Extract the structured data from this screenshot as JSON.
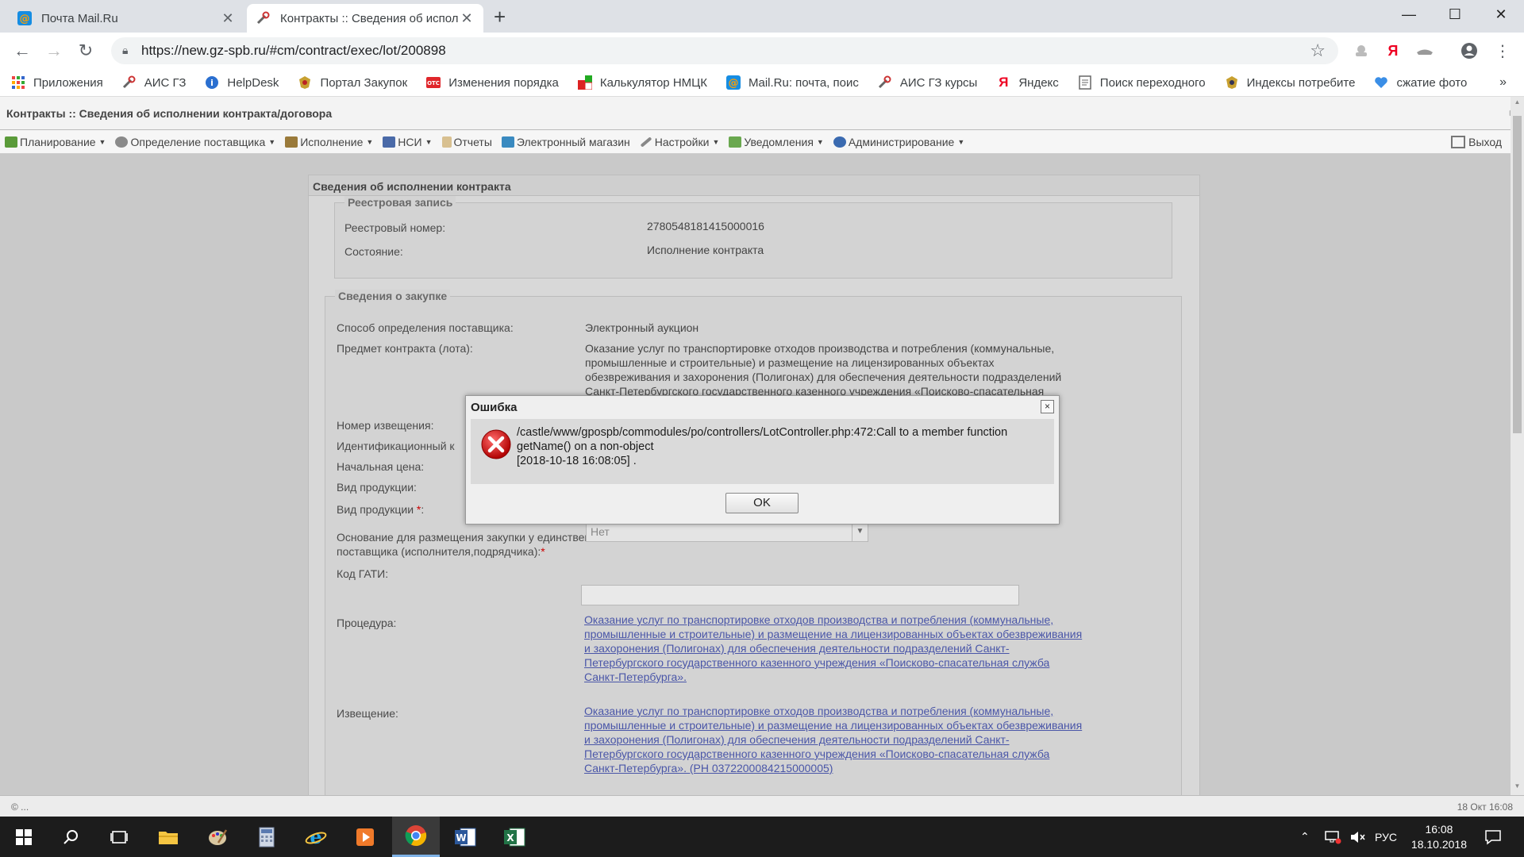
{
  "browser": {
    "tabs": [
      {
        "title": "Почта Mail.Ru",
        "favicon": "mailru-icon",
        "active": false
      },
      {
        "title": "Контракты :: Сведения об испол",
        "favicon": "tools-icon",
        "active": true
      }
    ],
    "url": "https://new.gz-spb.ru/#cm/contract/exec/lot/200898",
    "bookmarks": [
      {
        "label": "Приложения",
        "icon": "apps-grid-icon"
      },
      {
        "label": "АИС ГЗ",
        "icon": "tools-icon"
      },
      {
        "label": "HelpDesk",
        "icon": "info-globe-icon"
      },
      {
        "label": "Портал Закупок",
        "icon": "emblem-icon"
      },
      {
        "label": "Изменения порядка",
        "icon": "otc-icon"
      },
      {
        "label": "Калькулятор НМЦК",
        "icon": "calculator-icon"
      },
      {
        "label": "Mail.Ru: почта, поис",
        "icon": "mailru-icon"
      },
      {
        "label": "АИС ГЗ курсы",
        "icon": "tools-icon"
      },
      {
        "label": "Яндекс",
        "icon": "yandex-icon"
      },
      {
        "label": "Поиск переходного",
        "icon": "doc-icon"
      },
      {
        "label": "Индексы потребите",
        "icon": "emblem-icon"
      },
      {
        "label": "сжатие фото",
        "icon": "heart-icon"
      }
    ],
    "bookmarks_more": "»"
  },
  "app": {
    "window_title": "Контракты :: Сведения об исполнении контракта/договора",
    "menu": [
      {
        "label": "Планирование",
        "color": "#5b9b3a"
      },
      {
        "label": "Определение поставщика",
        "color": "#7a7a7a"
      },
      {
        "label": "Исполнение",
        "color": "#9a7a3a"
      },
      {
        "label": "НСИ",
        "color": "#4a6aa8"
      },
      {
        "label": "Отчеты",
        "color": "#c0a060"
      },
      {
        "label": "Электронный магазин",
        "color": "#3a8ac0"
      },
      {
        "label": "Настройки",
        "color": "#7a7a7a"
      },
      {
        "label": "Уведомления",
        "color": "#5b9b3a"
      },
      {
        "label": "Администрирование",
        "color": "#3a6ab0"
      }
    ],
    "logout": "Выход",
    "panel_title": "Сведения об исполнении контракта",
    "registry": {
      "legend": "Реестровая запись",
      "number_label": "Реестровый номер:",
      "number_value": "2780548181415000016",
      "state_label": "Состояние:",
      "state_value": "Исполнение контракта"
    },
    "purchase": {
      "legend": "Сведения о закупке",
      "method_label": "Способ определения поставщика:",
      "method_value": "Электронный аукцион",
      "subject_label": "Предмет контракта (лота):",
      "subject_lines": [
        "Оказание услуг по транспортировке отходов производства и потребления (коммунальные,",
        "промышленные и строительные) и размещение на лицензированных объектах",
        "обезвреживания и захоронения (Полигонах) для обеспечения деятельности подразделений",
        "Санкт-Петербургского государственного казенного учреждения «Поисково-спасательная"
      ],
      "notice_number_label": "Номер извещения:",
      "ident_label": "Идентификационный к",
      "start_price_label": "Начальная цена:",
      "product_type_label": "Вид продукции:",
      "product_type2_label": "Вид продукции",
      "required_mark": "*",
      "basis_label_1": "Основание для размещения закупки у единственного",
      "basis_label_2": "поставщика (исполнителя,подрядчика):",
      "basis_value": "Нет",
      "gati_label": "Код ГАТИ:",
      "procedure_label": "Процедура:",
      "procedure_lines": [
        "Оказание услуг по транспортировке отходов производства и потребления (коммунальные,",
        "промышленные и строительные) и размещение на лицензированных объектах обезвреживания",
        "и захоронения (Полигонах) для обеспечения деятельности подразделений Санкт-",
        "Петербургского государственного казенного учреждения «Поисково-спасательная служба",
        "Санкт-Петербурга»."
      ],
      "notice_label": "Извещение:",
      "notice_lines": [
        "Оказание услуг по транспортировке отходов производства и потребления (коммунальные,",
        "промышленные и строительные) и размещение на лицензированных объектах обезвреживания",
        "и захоронения (Полигонах) для обеспечения деятельности подразделений Санкт-",
        "Петербургского государственного казенного учреждения «Поисково-спасательная служба",
        "Санкт-Петербурга». (РН 0372200084215000005)"
      ]
    },
    "status_left": "© ...",
    "status_right": "18 Окт 16:08"
  },
  "dialog": {
    "title": "Ошибка",
    "close": "×",
    "message_line1": "/castle/www/gpospb/commodules/po/controllers/LotController.php:472:Call to a member function",
    "message_line2": "getName() on a non-object",
    "message_line3": "[2018-10-18 16:08:05] .",
    "ok_label": "OK"
  },
  "taskbar": {
    "lang": "РУС",
    "time": "16:08",
    "date": "18.10.2018"
  }
}
